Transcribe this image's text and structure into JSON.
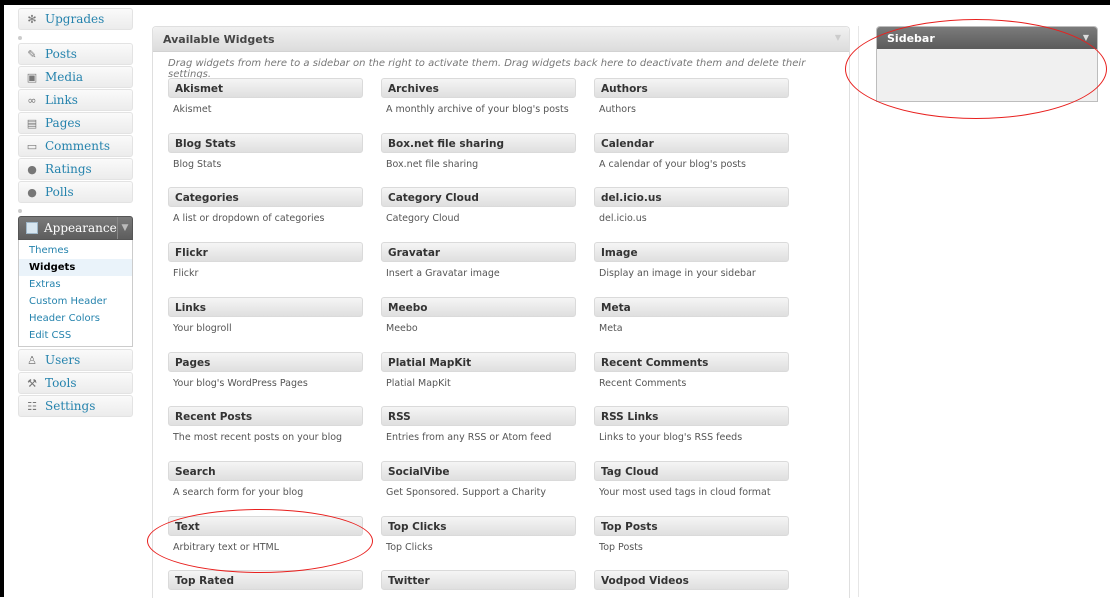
{
  "menu": {
    "upgrades": "Upgrades",
    "posts": "Posts",
    "media": "Media",
    "links": "Links",
    "pages": "Pages",
    "comments": "Comments",
    "ratings": "Ratings",
    "polls": "Polls",
    "appearance": "Appearance",
    "appearance_sub": [
      "Themes",
      "Widgets",
      "Extras",
      "Custom Header",
      "Header Colors",
      "Edit CSS"
    ],
    "users": "Users",
    "tools": "Tools",
    "settings": "Settings"
  },
  "available": {
    "title": "Available Widgets",
    "description": "Drag widgets from here to a sidebar on the right to activate them. Drag widgets back here to deactivate them and delete their settings."
  },
  "widgets": [
    {
      "title": "Akismet",
      "desc": "Akismet"
    },
    {
      "title": "Archives",
      "desc": "A monthly archive of your blog's posts"
    },
    {
      "title": "Authors",
      "desc": "Authors"
    },
    {
      "title": "Blog Stats",
      "desc": "Blog Stats"
    },
    {
      "title": "Box.net file sharing",
      "desc": "Box.net file sharing"
    },
    {
      "title": "Calendar",
      "desc": "A calendar of your blog's posts"
    },
    {
      "title": "Categories",
      "desc": "A list or dropdown of categories"
    },
    {
      "title": "Category Cloud",
      "desc": "Category Cloud"
    },
    {
      "title": "del.icio.us",
      "desc": "del.icio.us"
    },
    {
      "title": "Flickr",
      "desc": "Flickr"
    },
    {
      "title": "Gravatar",
      "desc": "Insert a Gravatar image"
    },
    {
      "title": "Image",
      "desc": "Display an image in your sidebar"
    },
    {
      "title": "Links",
      "desc": "Your blogroll"
    },
    {
      "title": "Meebo",
      "desc": "Meebo"
    },
    {
      "title": "Meta",
      "desc": "Meta"
    },
    {
      "title": "Pages",
      "desc": "Your blog's WordPress Pages"
    },
    {
      "title": "Platial MapKit",
      "desc": "Platial MapKit"
    },
    {
      "title": "Recent Comments",
      "desc": "Recent Comments"
    },
    {
      "title": "Recent Posts",
      "desc": "The most recent posts on your blog"
    },
    {
      "title": "RSS",
      "desc": "Entries from any RSS or Atom feed"
    },
    {
      "title": "RSS Links",
      "desc": "Links to your blog's RSS feeds"
    },
    {
      "title": "Search",
      "desc": "A search form for your blog"
    },
    {
      "title": "SocialVibe",
      "desc": "Get Sponsored. Support a Charity"
    },
    {
      "title": "Tag Cloud",
      "desc": "Your most used tags in cloud format"
    },
    {
      "title": "Text",
      "desc": "Arbitrary text or HTML"
    },
    {
      "title": "Top Clicks",
      "desc": "Top Clicks"
    },
    {
      "title": "Top Posts",
      "desc": "Top Posts"
    },
    {
      "title": "Top Rated",
      "desc": ""
    },
    {
      "title": "Twitter",
      "desc": ""
    },
    {
      "title": "Vodpod Videos",
      "desc": ""
    }
  ],
  "sidebar": {
    "title": "Sidebar"
  },
  "colors": {
    "link": "#2583ad",
    "annotation": "#e8201e",
    "sidebar_header": "#5b5b5b"
  }
}
